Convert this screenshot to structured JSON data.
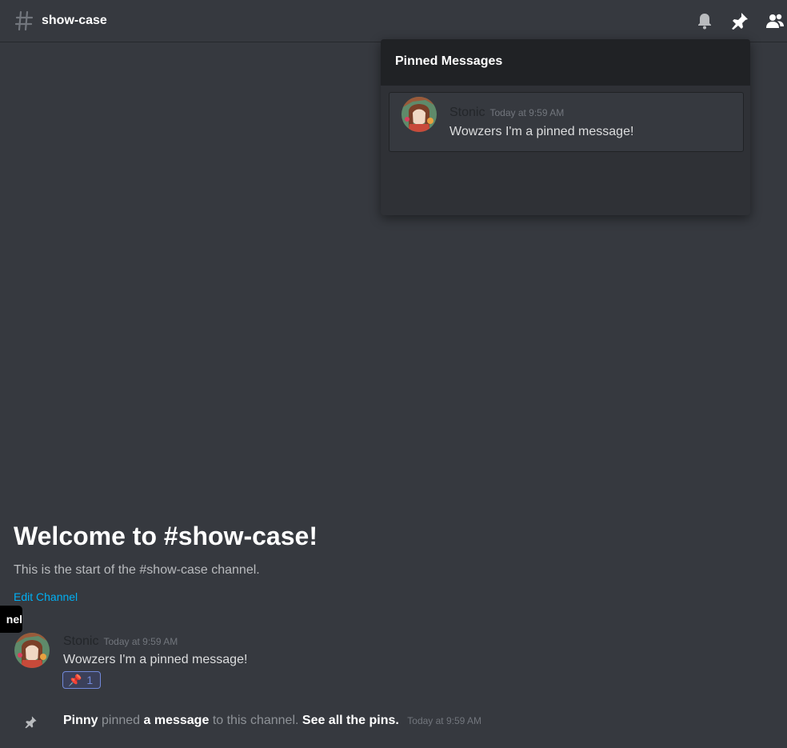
{
  "header": {
    "channel_name": "show-case",
    "icons": [
      "hashtag-icon",
      "bell-icon",
      "pin-icon",
      "members-icon"
    ]
  },
  "pinned_popout": {
    "title": "Pinned Messages",
    "messages": [
      {
        "username": "Stonic",
        "timestamp": "Today at 9:59 AM",
        "content": "Wowzers I'm a pinned message!"
      }
    ]
  },
  "welcome": {
    "title": "Welcome to #show-case!",
    "subtitle": "This is the start of the #show-case channel.",
    "edit_link": "Edit Channel"
  },
  "tooltip": {
    "text": "nel"
  },
  "messages": [
    {
      "username": "Stonic",
      "timestamp": "Today at 9:59 AM",
      "content": "Wowzers I'm a pinned message!",
      "reaction": {
        "emoji": "📌",
        "count": "1"
      }
    }
  ],
  "system_message": {
    "user": "Pinny",
    "action": "pinned",
    "link_message": "a message",
    "middle": "to this channel.",
    "link_pins": "See all the pins.",
    "timestamp": "Today at 9:59 AM",
    "icon": "pin-icon"
  },
  "colors": {
    "background": "#36393f",
    "header_bar": "#202225",
    "popout": "#2f3136",
    "link": "#00b0f4",
    "reaction_border": "#7289da"
  }
}
